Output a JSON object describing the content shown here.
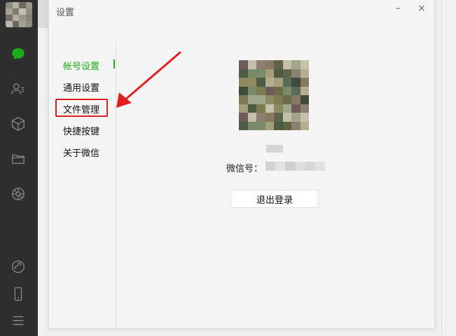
{
  "dialog": {
    "title": "设置",
    "minimize_label": "–",
    "close_label": "×"
  },
  "menu": {
    "items": [
      {
        "label": "帐号设置",
        "active": true
      },
      {
        "label": "通用设置",
        "active": false
      },
      {
        "label": "文件管理",
        "active": false
      },
      {
        "label": "快捷按键",
        "active": false
      },
      {
        "label": "关于微信",
        "active": false
      }
    ]
  },
  "profile": {
    "wxid_label": "微信号：",
    "logout_label": "退出登录"
  },
  "sidebar": {
    "icons": [
      "chat-icon",
      "contacts-icon",
      "cube-icon",
      "folder-icon",
      "moments-icon",
      "miniprogram-icon",
      "phone-icon",
      "menu-icon"
    ]
  },
  "colors": {
    "accent": "#1aad19",
    "highlight": "#e02020",
    "sidebar_bg": "#2e2e2e"
  }
}
